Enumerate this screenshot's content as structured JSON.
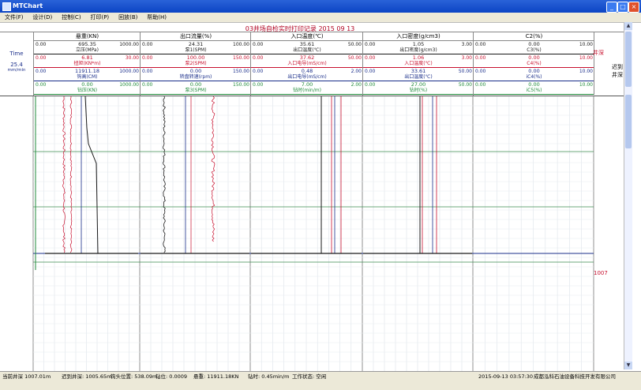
{
  "window": {
    "title": "MTChart"
  },
  "menu": [
    "文件(F)",
    "设计(D)",
    "控制(C)",
    "打印(P)",
    "回放(B)",
    "帮助(H)"
  ],
  "chart_title": "03井场自检实时打印记录  2015 09 13",
  "left_panel": {
    "label": "Time",
    "value": "25.4",
    "unit": "mm/min"
  },
  "right_panel": {
    "label1": "井深",
    "label2": "迟到",
    "label3": "井深",
    "depth_marker": "1007",
    "colors": {
      "red": "#c8102e",
      "dark": "#222222"
    }
  },
  "tracks": [
    {
      "name": "悬重(KN)",
      "curves": [
        {
          "value": "695.35",
          "label": "立压(MPa)",
          "min": "0.00",
          "max": "1000.00",
          "color": "#1a1a1a"
        },
        {
          "value": "6.81",
          "label": "扭矩(KN*m)",
          "min": "0.00",
          "max": "30.00",
          "color": "#c8102e"
        },
        {
          "value": "11911.18",
          "label": "钩高(CM)",
          "min": "0.00",
          "max": "1000.00",
          "color": "#1a2e8a"
        },
        {
          "value": "0.00",
          "label": "钻压(KN)",
          "min": "0.00",
          "max": "1000.00",
          "color": "#1f8a3a"
        }
      ]
    },
    {
      "name": "出口流量(%)",
      "curves": [
        {
          "value": "24.31",
          "label": "泵1(SPM)",
          "min": "0.00",
          "max": "100.00",
          "color": "#1a1a1a"
        },
        {
          "value": "100.00",
          "label": "泵2(SPM)",
          "min": "0.00",
          "max": "150.00",
          "color": "#c8102e"
        },
        {
          "value": "0.00",
          "label": "转盘转速(rpm)",
          "min": "0.00",
          "max": "150.00",
          "color": "#1a2e8a"
        },
        {
          "value": "0.00",
          "label": "泵3(SPM)",
          "min": "0.00",
          "max": "150.00",
          "color": "#1f8a3a"
        }
      ]
    },
    {
      "name": "入口温度(℃)",
      "curves": [
        {
          "value": "35.61",
          "label": "出口温度(℃)",
          "min": "0.00",
          "max": "50.00",
          "color": "#1a1a1a"
        },
        {
          "value": "37.62",
          "label": "入口电导(mS/cm)",
          "min": "0.00",
          "max": "50.00",
          "color": "#c8102e"
        },
        {
          "value": "0.48",
          "label": "出口电导(mS/cm)",
          "min": "0.00",
          "max": "2.00",
          "color": "#1a2e8a"
        },
        {
          "value": "7.00",
          "label": "钻时(min/m)",
          "min": "0.00",
          "max": "2.00",
          "color": "#1f8a3a"
        }
      ]
    },
    {
      "name": "入口密度(g/cm3)",
      "curves": [
        {
          "value": "1.05",
          "label": "出口密度(g/cm3)",
          "min": "0.00",
          "max": "3.00",
          "color": "#1a1a1a"
        },
        {
          "value": "1.06",
          "label": "入口温度(℃)",
          "min": "0.00",
          "max": "3.00",
          "color": "#c8102e"
        },
        {
          "value": "33.61",
          "label": "出口温度(℃)",
          "min": "0.00",
          "max": "50.00",
          "color": "#1a2e8a"
        },
        {
          "value": "27.00",
          "label": "钻时(%)",
          "min": "0.00",
          "max": "50.00",
          "color": "#1f8a3a"
        }
      ]
    },
    {
      "name": "C2(%)",
      "curves": [
        {
          "value": "0.00",
          "label": "C3(%)",
          "min": "0.00",
          "max": "10.00",
          "color": "#1a1a1a"
        },
        {
          "value": "0.00",
          "label": "C4(%)",
          "min": "0.00",
          "max": "10.00",
          "color": "#c8102e"
        },
        {
          "value": "0.00",
          "label": "iC4(%)",
          "min": "0.00",
          "max": "10.00",
          "color": "#1a2e8a"
        },
        {
          "value": "0.00",
          "label": "iC5(%)",
          "min": "0.00",
          "max": "10.00",
          "color": "#1f8a3a"
        }
      ]
    }
  ],
  "status": {
    "current_depth": "当前井深  1007.01m",
    "lag_depth": "迟到井深: 1005.65m",
    "hook_position": "钩头位置: 538.09m",
    "bit": "钻位: 0.0009",
    "hookload": "悬重: 11911.18KN",
    "rop": "钻时: 0.45min/m",
    "work_state": "工作状态: 空闲",
    "datetime": "2015-09-13 03:57:30",
    "company": "成都泓科石油设备科技开发有限公司"
  }
}
